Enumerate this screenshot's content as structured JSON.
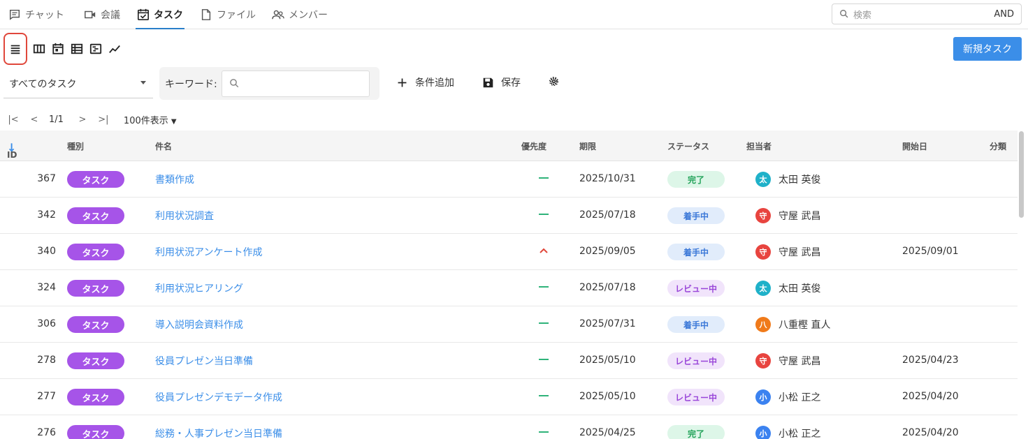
{
  "nav": {
    "tabs": [
      {
        "label": "チャット",
        "icon": "chat-icon"
      },
      {
        "label": "会議",
        "icon": "video-icon"
      },
      {
        "label": "タスク",
        "icon": "calendar-check-icon",
        "active": true
      },
      {
        "label": "ファイル",
        "icon": "file-icon"
      },
      {
        "label": "メンバー",
        "icon": "people-icon"
      }
    ],
    "search_placeholder": "検索",
    "search_mode": "AND"
  },
  "toolbar": {
    "new_task_label": "新規タスク",
    "filter_select_value": "すべてのタスク",
    "keyword_label": "キーワード:",
    "add_condition_label": "条件追加",
    "save_label": "保存"
  },
  "pager": {
    "page": "1/1",
    "per_page": "100件表示"
  },
  "columns": [
    "ID",
    "種別",
    "件名",
    "優先度",
    "期限",
    "ステータス",
    "担当者",
    "開始日",
    "分類"
  ],
  "rows": [
    {
      "id": "367",
      "kind": "タスク",
      "subject": "書類作成",
      "priority": "normal",
      "due": "2025/10/31",
      "status": "完了",
      "status_type": "done",
      "avatar": "太",
      "avatar_color": "#1fb1c9",
      "assignee": "太田 英俊",
      "start": ""
    },
    {
      "id": "342",
      "kind": "タスク",
      "subject": "利用状況調査",
      "priority": "normal",
      "due": "2025/07/18",
      "status": "着手中",
      "status_type": "doing",
      "avatar": "守",
      "avatar_color": "#e8443f",
      "assignee": "守屋 武昌",
      "start": ""
    },
    {
      "id": "340",
      "kind": "タスク",
      "subject": "利用状況アンケート作成",
      "priority": "high",
      "due": "2025/09/05",
      "status": "着手中",
      "status_type": "doing",
      "avatar": "守",
      "avatar_color": "#e8443f",
      "assignee": "守屋 武昌",
      "start": "2025/09/01"
    },
    {
      "id": "324",
      "kind": "タスク",
      "subject": "利用状況ヒアリング",
      "priority": "normal",
      "due": "2025/07/18",
      "status": "レビュー中",
      "status_type": "review",
      "avatar": "太",
      "avatar_color": "#1fb1c9",
      "assignee": "太田 英俊",
      "start": ""
    },
    {
      "id": "306",
      "kind": "タスク",
      "subject": "導入説明会資料作成",
      "priority": "normal",
      "due": "2025/07/31",
      "status": "着手中",
      "status_type": "doing",
      "avatar": "八",
      "avatar_color": "#f07a1a",
      "assignee": "八重樫 直人",
      "start": ""
    },
    {
      "id": "278",
      "kind": "タスク",
      "subject": "役員プレゼン当日準備",
      "priority": "normal",
      "due": "2025/05/10",
      "status": "レビュー中",
      "status_type": "review",
      "avatar": "守",
      "avatar_color": "#e8443f",
      "assignee": "守屋 武昌",
      "start": "2025/04/23"
    },
    {
      "id": "277",
      "kind": "タスク",
      "subject": "役員プレゼンデモデータ作成",
      "priority": "normal",
      "due": "2025/05/10",
      "status": "レビュー中",
      "status_type": "review",
      "avatar": "小",
      "avatar_color": "#3b82f0",
      "assignee": "小松 正之",
      "start": "2025/04/20"
    },
    {
      "id": "276",
      "kind": "タスク",
      "subject": "総務・人事プレゼン当日準備",
      "priority": "normal",
      "due": "2025/04/25",
      "status": "完了",
      "status_type": "done",
      "avatar": "小",
      "avatar_color": "#3b82f0",
      "assignee": "小松 正之",
      "start": "2025/04/20"
    }
  ]
}
